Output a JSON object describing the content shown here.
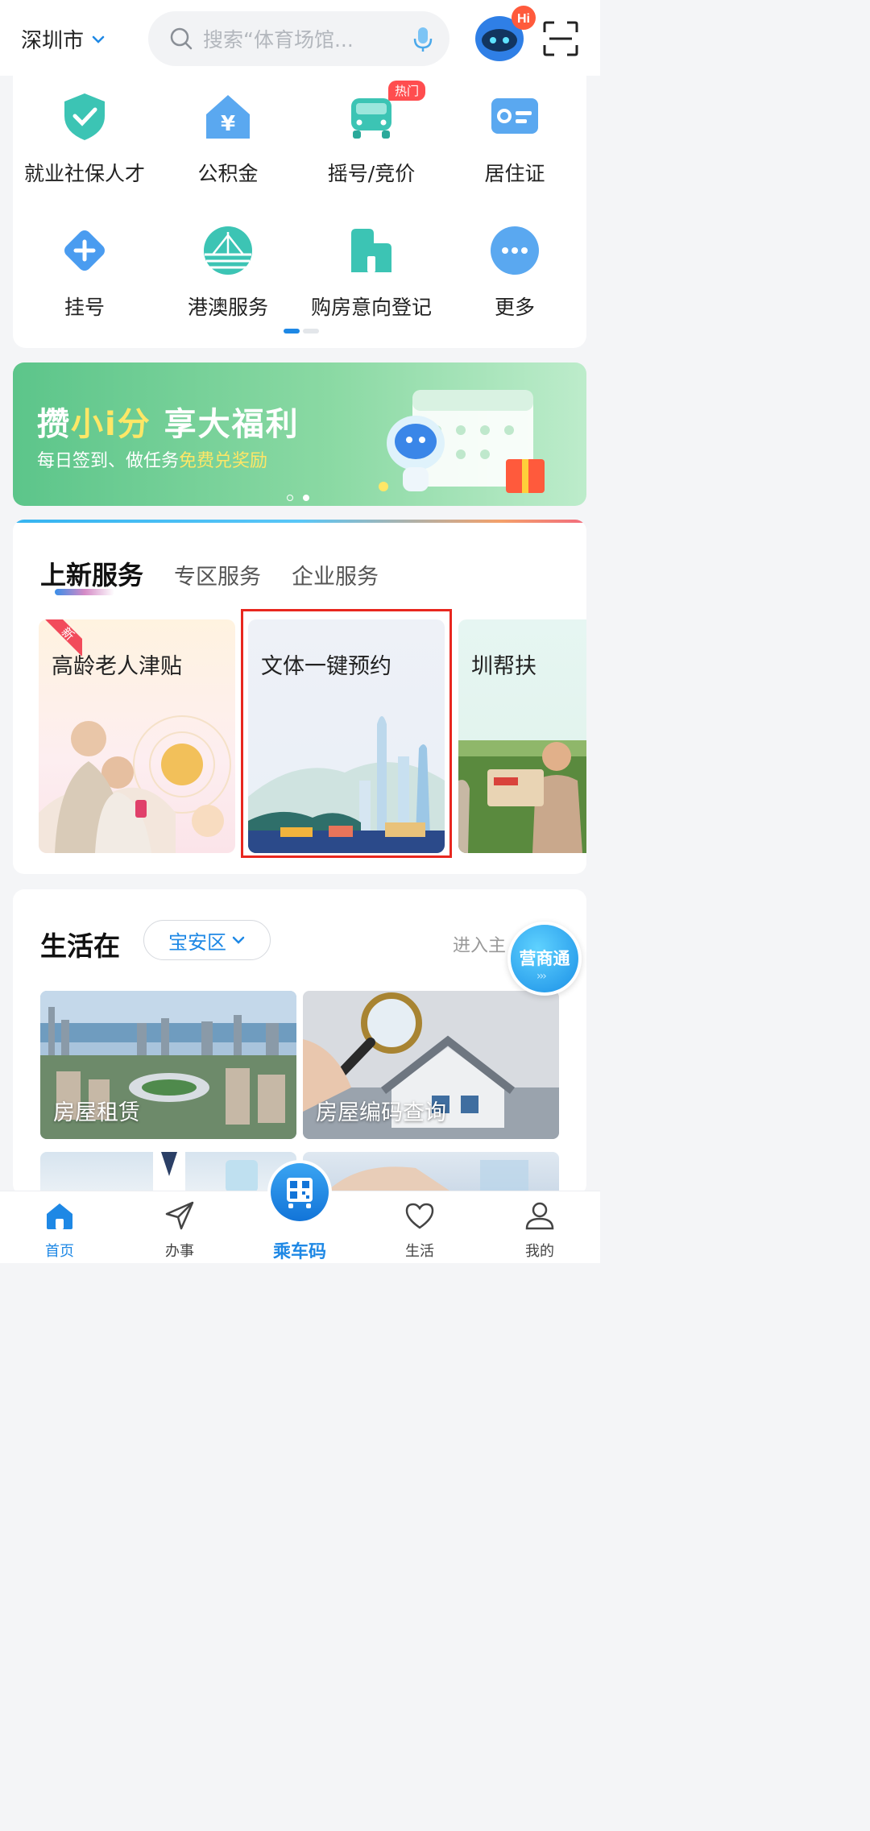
{
  "header": {
    "city": "深圳市",
    "search_placeholder": "搜索“体育场馆...",
    "robot_badge": "Hi"
  },
  "services": [
    {
      "label": "就业社保人才",
      "icon": "shield-check-icon"
    },
    {
      "label": "公积金",
      "icon": "house-yuan-icon"
    },
    {
      "label": "摇号/竞价",
      "icon": "car-icon",
      "badge": "热门"
    },
    {
      "label": "居住证",
      "icon": "id-card-icon"
    },
    {
      "label": "挂号",
      "icon": "medical-cross-icon"
    },
    {
      "label": "港澳服务",
      "icon": "bridge-icon"
    },
    {
      "label": "购房意向登记",
      "icon": "building-icon"
    },
    {
      "label": "更多",
      "icon": "more-icon"
    }
  ],
  "banner": {
    "title_a": "攒",
    "title_b": "小i分",
    "title_c": " 享大福利",
    "sub_a": "每日签到、做任务",
    "sub_b": "免费兑奖励"
  },
  "new_services": {
    "tabs": [
      "上新服务",
      "专区服务",
      "企业服务"
    ],
    "new_badge": "新",
    "cards": [
      {
        "title": "高龄老人津贴"
      },
      {
        "title": "文体一键预约"
      },
      {
        "title": "圳帮扶"
      }
    ]
  },
  "life": {
    "heading": "生活在",
    "district": "宝安区",
    "enter_label": "进入主",
    "tiles": [
      {
        "title": "房屋租赁"
      },
      {
        "title": "房屋编码查询"
      }
    ],
    "float_label": "营商通",
    "float_arrows": "›››"
  },
  "nav": {
    "home": "首页",
    "tasks": "办事",
    "ride": "乘车码",
    "life": "生活",
    "mine": "我的"
  },
  "colors": {
    "accent": "#1e88e5",
    "highlight": "#e8271f",
    "banner": "#5cc58a"
  }
}
